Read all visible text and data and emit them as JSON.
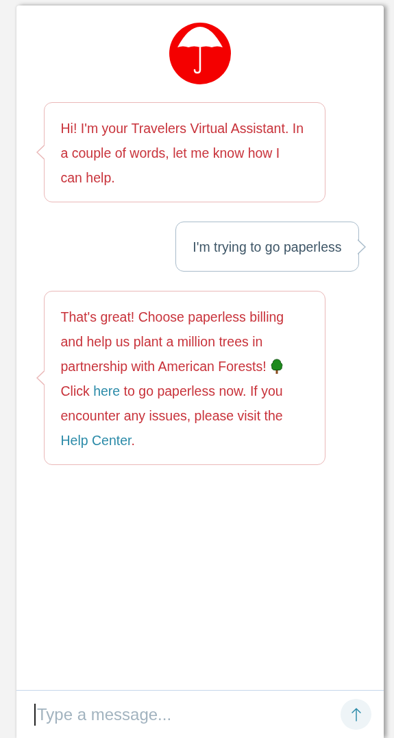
{
  "messages": [
    {
      "kind": "bot",
      "parts": [
        {
          "kind": "text",
          "text": "Hi! I'm your Travelers Virtual Assistant. In a couple of words, let me know how I can help."
        }
      ]
    },
    {
      "kind": "user",
      "parts": [
        {
          "kind": "text",
          "text": "I'm trying to go paperless"
        }
      ]
    },
    {
      "kind": "bot",
      "parts": [
        {
          "kind": "text",
          "text": "That's great! Choose paperless billing and help us plant a million trees in partnership with American Forests! "
        },
        {
          "kind": "tree"
        },
        {
          "kind": "text",
          "text": " Click "
        },
        {
          "kind": "link",
          "text": "here"
        },
        {
          "kind": "text",
          "text": " to go paperless now. If you encounter any issues, please visit the "
        },
        {
          "kind": "link",
          "text": "Help Center"
        },
        {
          "kind": "text",
          "text": "."
        }
      ]
    }
  ],
  "composer": {
    "placeholder": "Type a message..."
  }
}
